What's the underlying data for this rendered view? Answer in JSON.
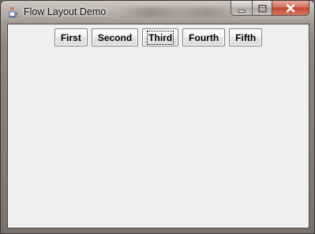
{
  "window": {
    "title": "Flow Layout Demo",
    "icon": "java-cup-icon",
    "controls": [
      "minimize-icon",
      "maximize-icon",
      "close-icon"
    ]
  },
  "buttons": [
    {
      "label": "First"
    },
    {
      "label": "Second"
    },
    {
      "label": "Third",
      "focused": true
    },
    {
      "label": "Fourth"
    },
    {
      "label": "Fifth"
    }
  ],
  "colors": {
    "content_background": "#f0f0f0",
    "close_button": "#c2472f"
  }
}
